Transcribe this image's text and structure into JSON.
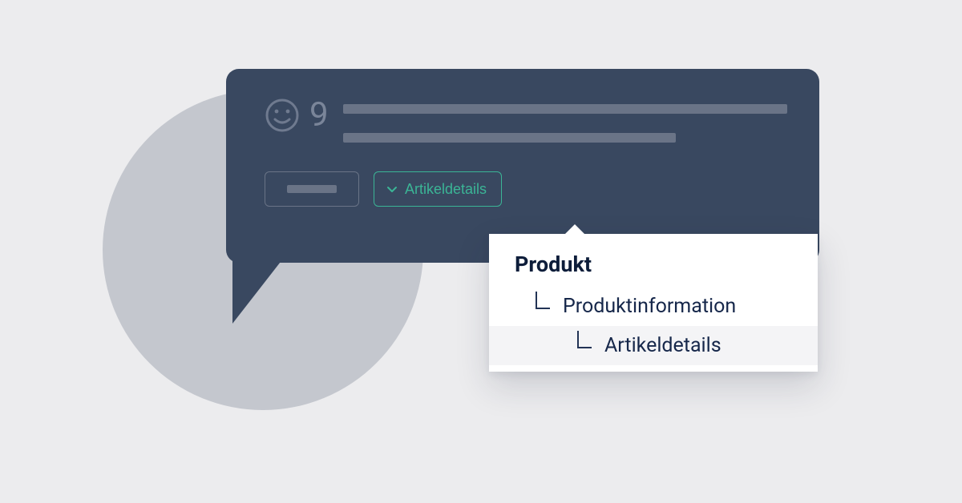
{
  "colors": {
    "bubble_bg": "#394860",
    "accent": "#3bb596",
    "panel_bg": "#ffffff",
    "page_bg": "#ececee",
    "circle_bg": "#c4c7ce"
  },
  "review_card": {
    "rating_value": "9",
    "icon": "smiley-icon",
    "details_button_label": "Artikeldetails"
  },
  "breadcrumb_popup": {
    "title": "Produkt",
    "items": [
      {
        "label": "Produktinformation",
        "level": 1
      },
      {
        "label": "Artikeldetails",
        "level": 2
      }
    ]
  }
}
